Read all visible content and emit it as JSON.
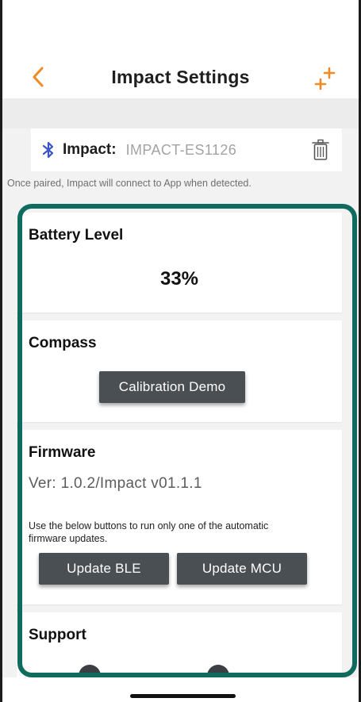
{
  "nav": {
    "title": "Impact Settings",
    "back_icon": "chevron-left-icon",
    "add_icon": "add-device-icon",
    "accent_color": "#f08a24"
  },
  "device": {
    "label": "Impact:",
    "value": "IMPACT-ES1126",
    "icon": "bluetooth-icon",
    "delete_icon": "trash-icon",
    "note": "Once paired, Impact will connect to App when detected."
  },
  "battery": {
    "title": "Battery Level",
    "value": "33%"
  },
  "compass": {
    "title": "Compass",
    "button_label": "Calibration Demo"
  },
  "firmware": {
    "title": "Firmware",
    "version": "Ver: 1.0.2/Impact v01.1.1",
    "note": "Use the below buttons to run only one of the automatic firmware updates.",
    "update_ble_label": "Update BLE",
    "update_mcu_label": "Update MCU"
  },
  "support": {
    "title": "Support"
  },
  "colors": {
    "frame": "#0e6b5d",
    "button": "#4a4f53",
    "bluetooth": "#3a55c8"
  }
}
